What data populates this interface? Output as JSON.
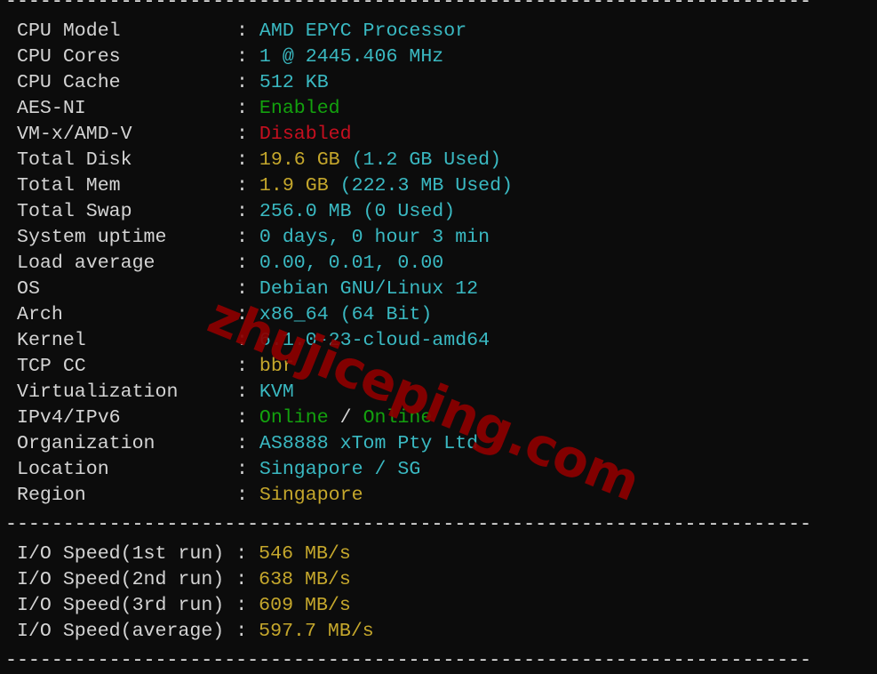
{
  "separator": "----------------------------------------------------------------------",
  "colors": {
    "background": "#0c0c0c",
    "label": "#d4d4d4",
    "cyan": "#3ab9c2",
    "yellow": "#c5a72c",
    "green": "#13a10e",
    "red": "#c50f1f",
    "watermark": "#8b0000"
  },
  "system_info": [
    {
      "label": "CPU Model",
      "parts": [
        {
          "text": "AMD EPYC Processor",
          "color": "cyan"
        }
      ]
    },
    {
      "label": "CPU Cores",
      "parts": [
        {
          "text": "1 @ 2445.406 MHz",
          "color": "cyan"
        }
      ]
    },
    {
      "label": "CPU Cache",
      "parts": [
        {
          "text": "512 KB",
          "color": "cyan"
        }
      ]
    },
    {
      "label": "AES-NI",
      "parts": [
        {
          "text": "Enabled",
          "color": "green"
        }
      ]
    },
    {
      "label": "VM-x/AMD-V",
      "parts": [
        {
          "text": "Disabled",
          "color": "red"
        }
      ]
    },
    {
      "label": "Total Disk",
      "parts": [
        {
          "text": "19.6 GB",
          "color": "yellow"
        },
        {
          "text": " (1.2 GB Used)",
          "color": "cyan"
        }
      ]
    },
    {
      "label": "Total Mem",
      "parts": [
        {
          "text": "1.9 GB",
          "color": "yellow"
        },
        {
          "text": " (222.3 MB Used)",
          "color": "cyan"
        }
      ]
    },
    {
      "label": "Total Swap",
      "parts": [
        {
          "text": "256.0 MB (0 Used)",
          "color": "cyan"
        }
      ]
    },
    {
      "label": "System uptime",
      "parts": [
        {
          "text": "0 days, 0 hour 3 min",
          "color": "cyan"
        }
      ]
    },
    {
      "label": "Load average",
      "parts": [
        {
          "text": "0.00, 0.01, 0.00",
          "color": "cyan"
        }
      ]
    },
    {
      "label": "OS",
      "parts": [
        {
          "text": "Debian GNU/Linux 12",
          "color": "cyan"
        }
      ]
    },
    {
      "label": "Arch",
      "parts": [
        {
          "text": "x86_64 (64 Bit)",
          "color": "cyan"
        }
      ]
    },
    {
      "label": "Kernel",
      "parts": [
        {
          "text": "6.1.0-23-cloud-amd64",
          "color": "cyan"
        }
      ]
    },
    {
      "label": "TCP CC",
      "parts": [
        {
          "text": "bbr",
          "color": "yellow"
        }
      ]
    },
    {
      "label": "Virtualization",
      "parts": [
        {
          "text": "KVM",
          "color": "cyan"
        }
      ]
    },
    {
      "label": "IPv4/IPv6",
      "parts": [
        {
          "text": "Online",
          "color": "green"
        },
        {
          "text": " / ",
          "color": "white"
        },
        {
          "text": "Online",
          "color": "green"
        }
      ]
    },
    {
      "label": "Organization",
      "parts": [
        {
          "text": "AS8888 xTom Pty Ltd",
          "color": "cyan"
        }
      ]
    },
    {
      "label": "Location",
      "parts": [
        {
          "text": "Singapore / SG",
          "color": "cyan"
        }
      ]
    },
    {
      "label": "Region",
      "parts": [
        {
          "text": "Singapore",
          "color": "yellow"
        }
      ]
    }
  ],
  "io_speed": [
    {
      "label": "I/O Speed(1st run)",
      "value": "546 MB/s"
    },
    {
      "label": "I/O Speed(2nd run)",
      "value": "638 MB/s"
    },
    {
      "label": "I/O Speed(3rd run)",
      "value": "609 MB/s"
    },
    {
      "label": "I/O Speed(average)",
      "value": "597.7 MB/s"
    }
  ],
  "watermark": "zhujiceping.com"
}
